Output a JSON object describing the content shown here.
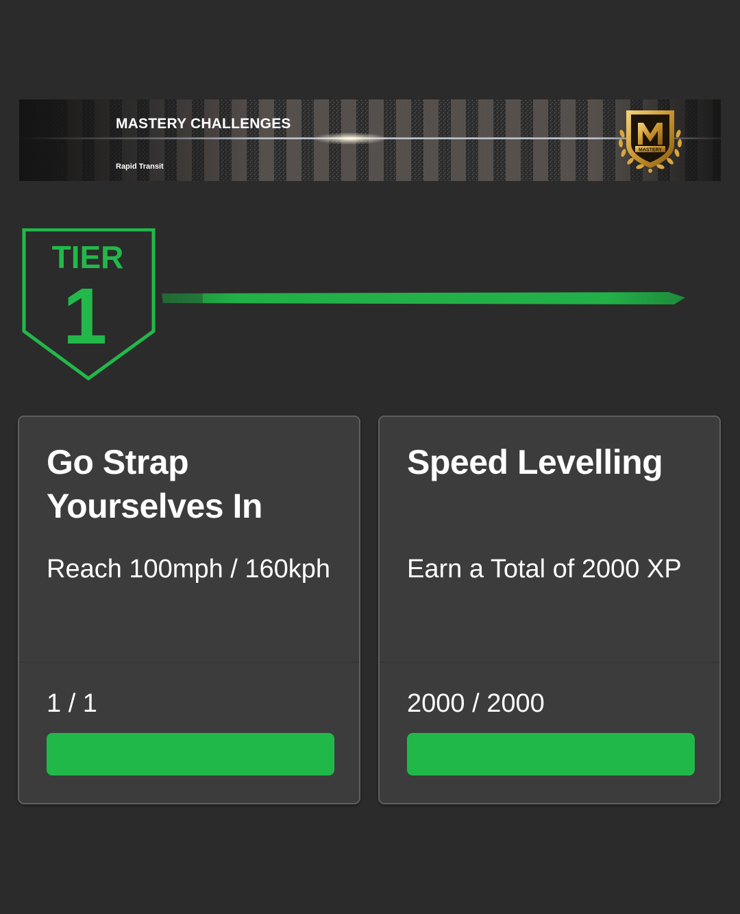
{
  "banner": {
    "title": "MASTERY CHALLENGES",
    "subtitle": "Rapid Transit",
    "badge_icon": "mastery-emblem",
    "badge_text": "MASTERY"
  },
  "tier": {
    "label": "TIER",
    "number": "1",
    "color": "#22b84a",
    "progress_fraction": 1.0
  },
  "challenges": [
    {
      "title": "Go Strap Yourselves In",
      "description": "Reach 100mph / 160kph",
      "progress_text": "1 / 1",
      "progress_fraction": 1.0
    },
    {
      "title": "Speed Levelling",
      "description": "Earn a Total of 2000 XP",
      "progress_text": "2000 / 2000",
      "progress_fraction": 1.0
    }
  ],
  "colors": {
    "background": "#2b2b2b",
    "card": "#3c3c3c",
    "card_border": "#5f5f5f",
    "progress_fill": "#21b84a",
    "tier_green": "#22b84a",
    "mastery_gold": "#d4a640"
  }
}
